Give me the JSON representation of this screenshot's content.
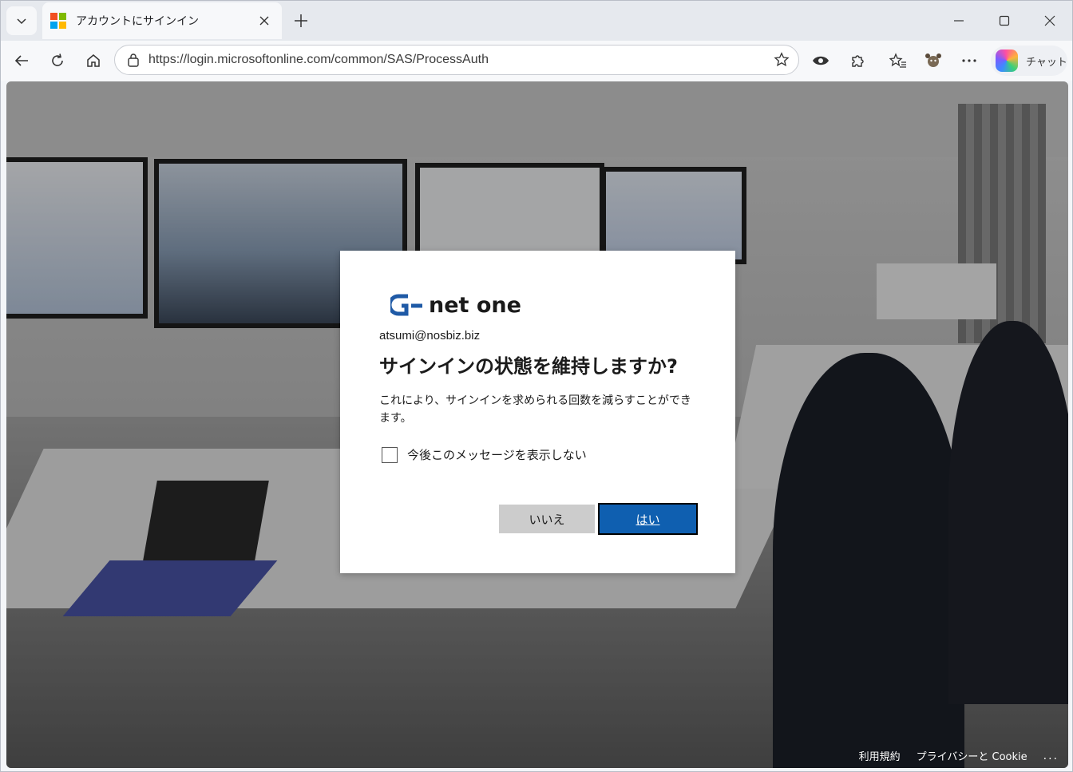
{
  "browser": {
    "tab": {
      "title": "アカウントにサインイン"
    },
    "address_bar": {
      "url": "https://login.microsoftonline.com/common/SAS/ProcessAuth"
    },
    "copilot": {
      "label": "チャット"
    }
  },
  "dialog": {
    "logo_text": "net one",
    "account_email": "atsumi@nosbiz.biz",
    "title": "サインインの状態を維持しますか?",
    "description": "これにより、サインインを求められる回数を減らすことができます。",
    "checkbox_label": "今後このメッセージを表示しない",
    "checkbox_checked": false,
    "no_button": "いいえ",
    "yes_button": "はい"
  },
  "footer": {
    "terms": "利用規約",
    "privacy": "プライバシーと Cookie",
    "more": "..."
  },
  "colors": {
    "primary_button": "#0f5fb0",
    "secondary_button": "#cccccc",
    "brand_logo": "#1f5aa6"
  }
}
